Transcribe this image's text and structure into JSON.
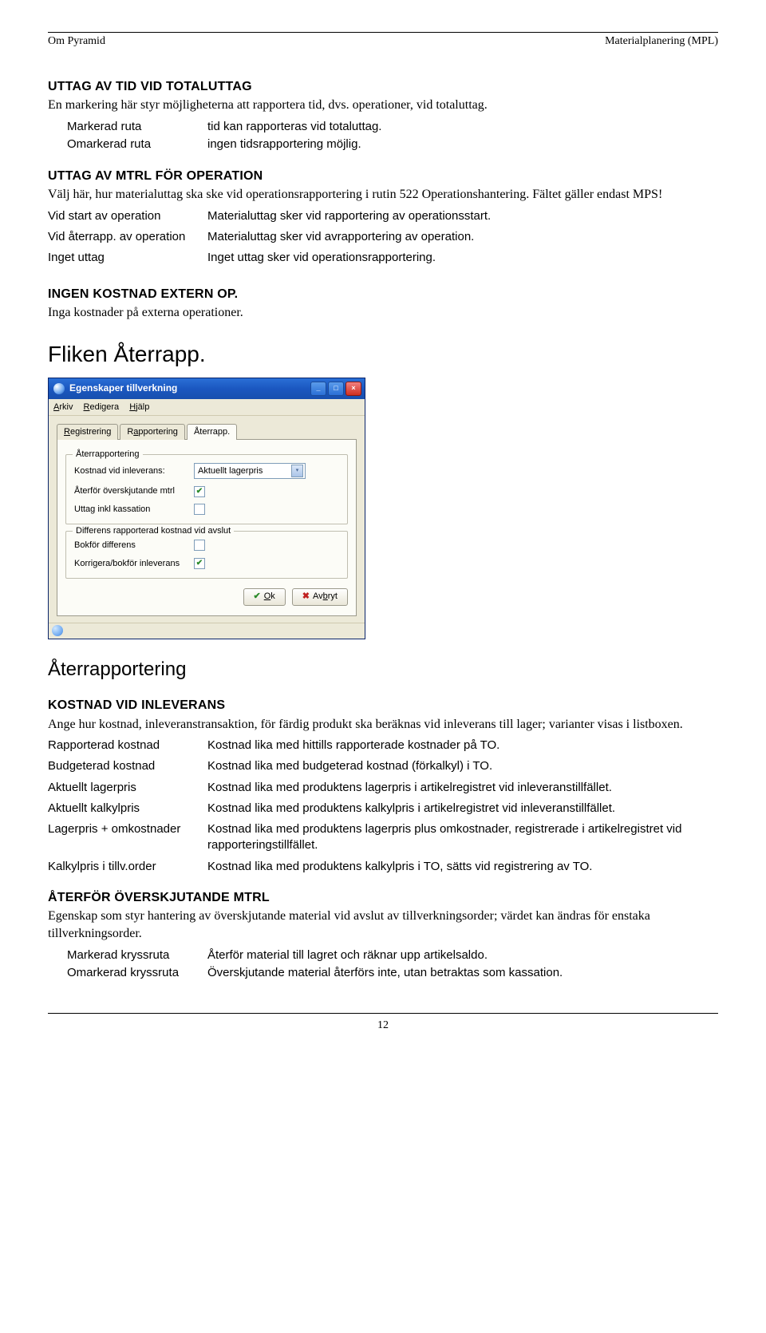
{
  "header": {
    "left": "Om Pyramid",
    "right": "Materialplanering (MPL)"
  },
  "sec1": {
    "title": "UTTAG AV TID VID TOTALUTTAG",
    "intro": "En markering här styr möjligheterna att rapportera tid, dvs. operationer, vid totaluttag.",
    "rows": [
      {
        "a": "Markerad ruta",
        "b": "tid kan rapporteras vid totaluttag."
      },
      {
        "a": "Omarkerad ruta",
        "b": "ingen tidsrapportering möjlig."
      }
    ]
  },
  "sec2": {
    "title": "UTTAG AV MTRL FÖR OPERATION",
    "intro": "Välj här, hur materialuttag ska ske vid operationsrapportering i rutin 522 Operationshantering. Fältet gäller endast MPS!",
    "rows": [
      {
        "a": "Vid start av operation",
        "b": "Materialuttag sker vid rapportering av operationsstart."
      },
      {
        "a": "Vid återrapp. av operation",
        "b": "Materialuttag sker vid avrapportering av operation."
      },
      {
        "a": "Inget uttag",
        "b": "Inget uttag sker vid operationsrapportering."
      }
    ]
  },
  "sec3": {
    "title": "INGEN KOSTNAD EXTERN OP.",
    "intro": "Inga kostnader på externa operationer."
  },
  "tab_heading": "Fliken Återrapp.",
  "dialog": {
    "title": "Egenskaper tillverkning",
    "menu": {
      "arkiv": "Arkiv",
      "redigera": "Redigera",
      "hjalp": "Hjälp"
    },
    "tabs": [
      "Registrering",
      "Rapportering",
      "Återrapp."
    ],
    "group1": {
      "legend": "Återrapportering",
      "row1_label": "Kostnad vid inleverans:",
      "row1_value": "Aktuellt lagerpris",
      "row2_label": "Återför överskjutande mtrl",
      "row2_checked": true,
      "row3_label": "Uttag inkl kassation",
      "row3_checked": false
    },
    "group2": {
      "legend": "Differens rapporterad kostnad vid avslut",
      "row1_label": "Bokför differens",
      "row1_checked": false,
      "row2_label": "Korrigera/bokför inleverans",
      "row2_checked": true
    },
    "ok": "Ok",
    "cancel": "Avbryt"
  },
  "h3": "Återrapportering",
  "sec4": {
    "title": "KOSTNAD VID INLEVERANS",
    "intro": "Ange hur kostnad, inleveranstransaktion, för färdig produkt ska beräknas vid inleverans till lager; varianter visas i listboxen.",
    "rows": [
      {
        "a": "Rapporterad kostnad",
        "b": "Kostnad lika med hittills rapporterade kostnader på TO."
      },
      {
        "a": "Budgeterad kostnad",
        "b": "Kostnad lika med budgeterad kostnad (förkalkyl) i TO."
      },
      {
        "a": "Aktuellt lagerpris",
        "b": "Kostnad lika med produktens lagerpris i artikelregistret vid inleveranstillfället."
      },
      {
        "a": "Aktuellt kalkylpris",
        "b": "Kostnad lika med produktens kalkylpris i artikelregistret vid inleveranstillfället."
      },
      {
        "a": "Lagerpris + omkostnader",
        "b": "Kostnad lika med produktens lagerpris plus omkostnader, registrerade i artikelregistret vid rapporteringstillfället."
      },
      {
        "a": "Kalkylpris i tillv.order",
        "b": "Kostnad lika med produktens kalkylpris i TO, sätts vid registrering av TO."
      }
    ]
  },
  "sec5": {
    "title": "ÅTERFÖR ÖVERSKJUTANDE MTRL",
    "intro": "Egenskap som styr hantering av överskjutande material vid avslut av tillverkningsorder; värdet kan ändras för enstaka tillverkningsorder.",
    "rows": [
      {
        "a": "Markerad kryssruta",
        "b": "Återför material till lagret och räknar upp artikelsaldo."
      },
      {
        "a": "Omarkerad kryssruta",
        "b": "Överskjutande material återförs inte, utan betraktas som kassation."
      }
    ]
  },
  "page_num": "12"
}
